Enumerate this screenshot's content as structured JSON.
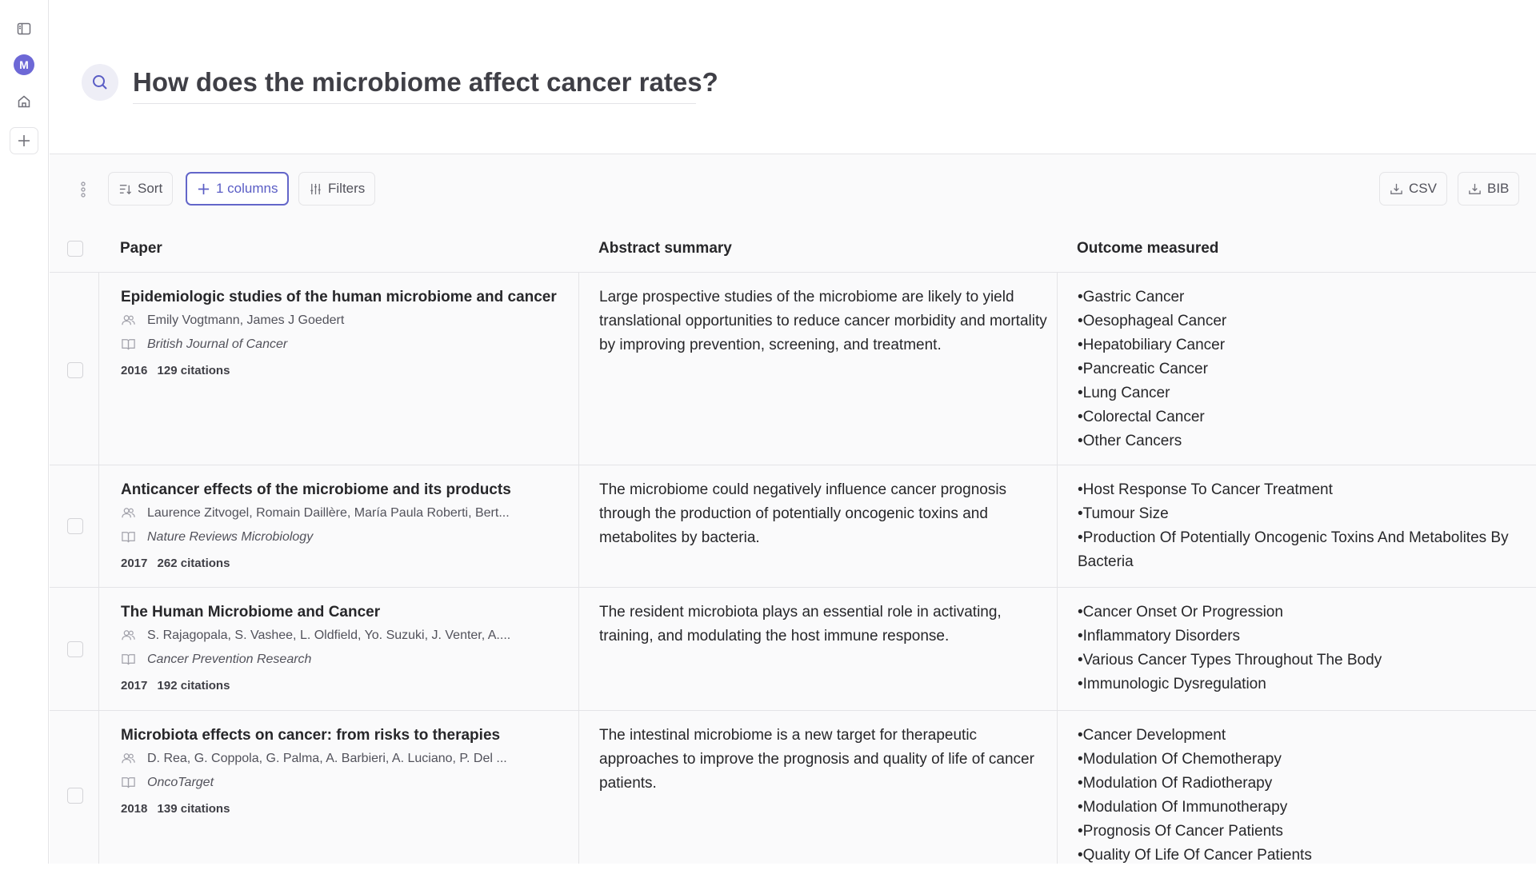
{
  "search": {
    "query": "How does the microbiome affect cancer rates?"
  },
  "sidebar": {
    "avatar_initial": "M"
  },
  "toolbar": {
    "sort_label": "Sort",
    "columns_label": "1 columns",
    "filters_label": "Filters",
    "csv_label": "CSV",
    "bib_label": "BIB"
  },
  "table": {
    "headers": {
      "paper": "Paper",
      "summary": "Abstract summary",
      "outcome": "Outcome measured"
    },
    "rows": [
      {
        "title": "Epidemiologic studies of the human microbiome and cancer",
        "authors": "Emily Vogtmann, James J Goedert",
        "journal": "British Journal of Cancer",
        "year": "2016",
        "citations": "129 citations",
        "summary": "Large prospective studies of the microbiome are likely to yield translational opportunities to reduce cancer morbidity and mortality by improving prevention, screening, and treatment.",
        "outcomes": [
          "•Gastric Cancer",
          "•Oesophageal Cancer",
          "•Hepatobiliary Cancer",
          "•Pancreatic Cancer",
          "•Lung Cancer",
          "•Colorectal Cancer",
          "•Other Cancers"
        ]
      },
      {
        "title": "Anticancer effects of the microbiome and its products",
        "authors": "Laurence Zitvogel, Romain Daillère, María Paula Roberti, Bert...",
        "journal": "Nature Reviews Microbiology",
        "year": "2017",
        "citations": "262 citations",
        "summary": "The microbiome could negatively influence cancer prognosis through the production of potentially oncogenic toxins and metabolites by bacteria.",
        "outcomes": [
          "•Host Response To Cancer Treatment",
          "•Tumour Size",
          "•Production Of Potentially Oncogenic Toxins And Metabolites By Bacteria"
        ]
      },
      {
        "title": "The Human Microbiome and Cancer",
        "authors": "S. Rajagopala, S. Vashee, L. Oldfield, Yo. Suzuki, J. Venter, A....",
        "journal": "Cancer Prevention Research",
        "year": "2017",
        "citations": "192 citations",
        "summary": "The resident microbiota plays an essential role in activating, training, and modulating the host immune response.",
        "outcomes": [
          "•Cancer Onset Or Progression",
          "•Inflammatory Disorders",
          "•Various Cancer Types Throughout The Body",
          "•Immunologic Dysregulation"
        ]
      },
      {
        "title": "Microbiota effects on cancer: from risks to therapies",
        "authors": "D. Rea, G. Coppola, G. Palma, A. Barbieri, A. Luciano, P. Del ...",
        "journal": "OncoTarget",
        "year": "2018",
        "citations": "139 citations",
        "summary": "The intestinal microbiome is a new target for therapeutic approaches to improve the prognosis and quality of life of cancer patients.",
        "outcomes": [
          "•Cancer Development",
          "•Modulation Of Chemotherapy",
          "•Modulation Of Radiotherapy",
          "•Modulation Of Immunotherapy",
          "•Prognosis Of Cancer Patients",
          "•Quality Of Life Of Cancer Patients"
        ]
      }
    ]
  }
}
